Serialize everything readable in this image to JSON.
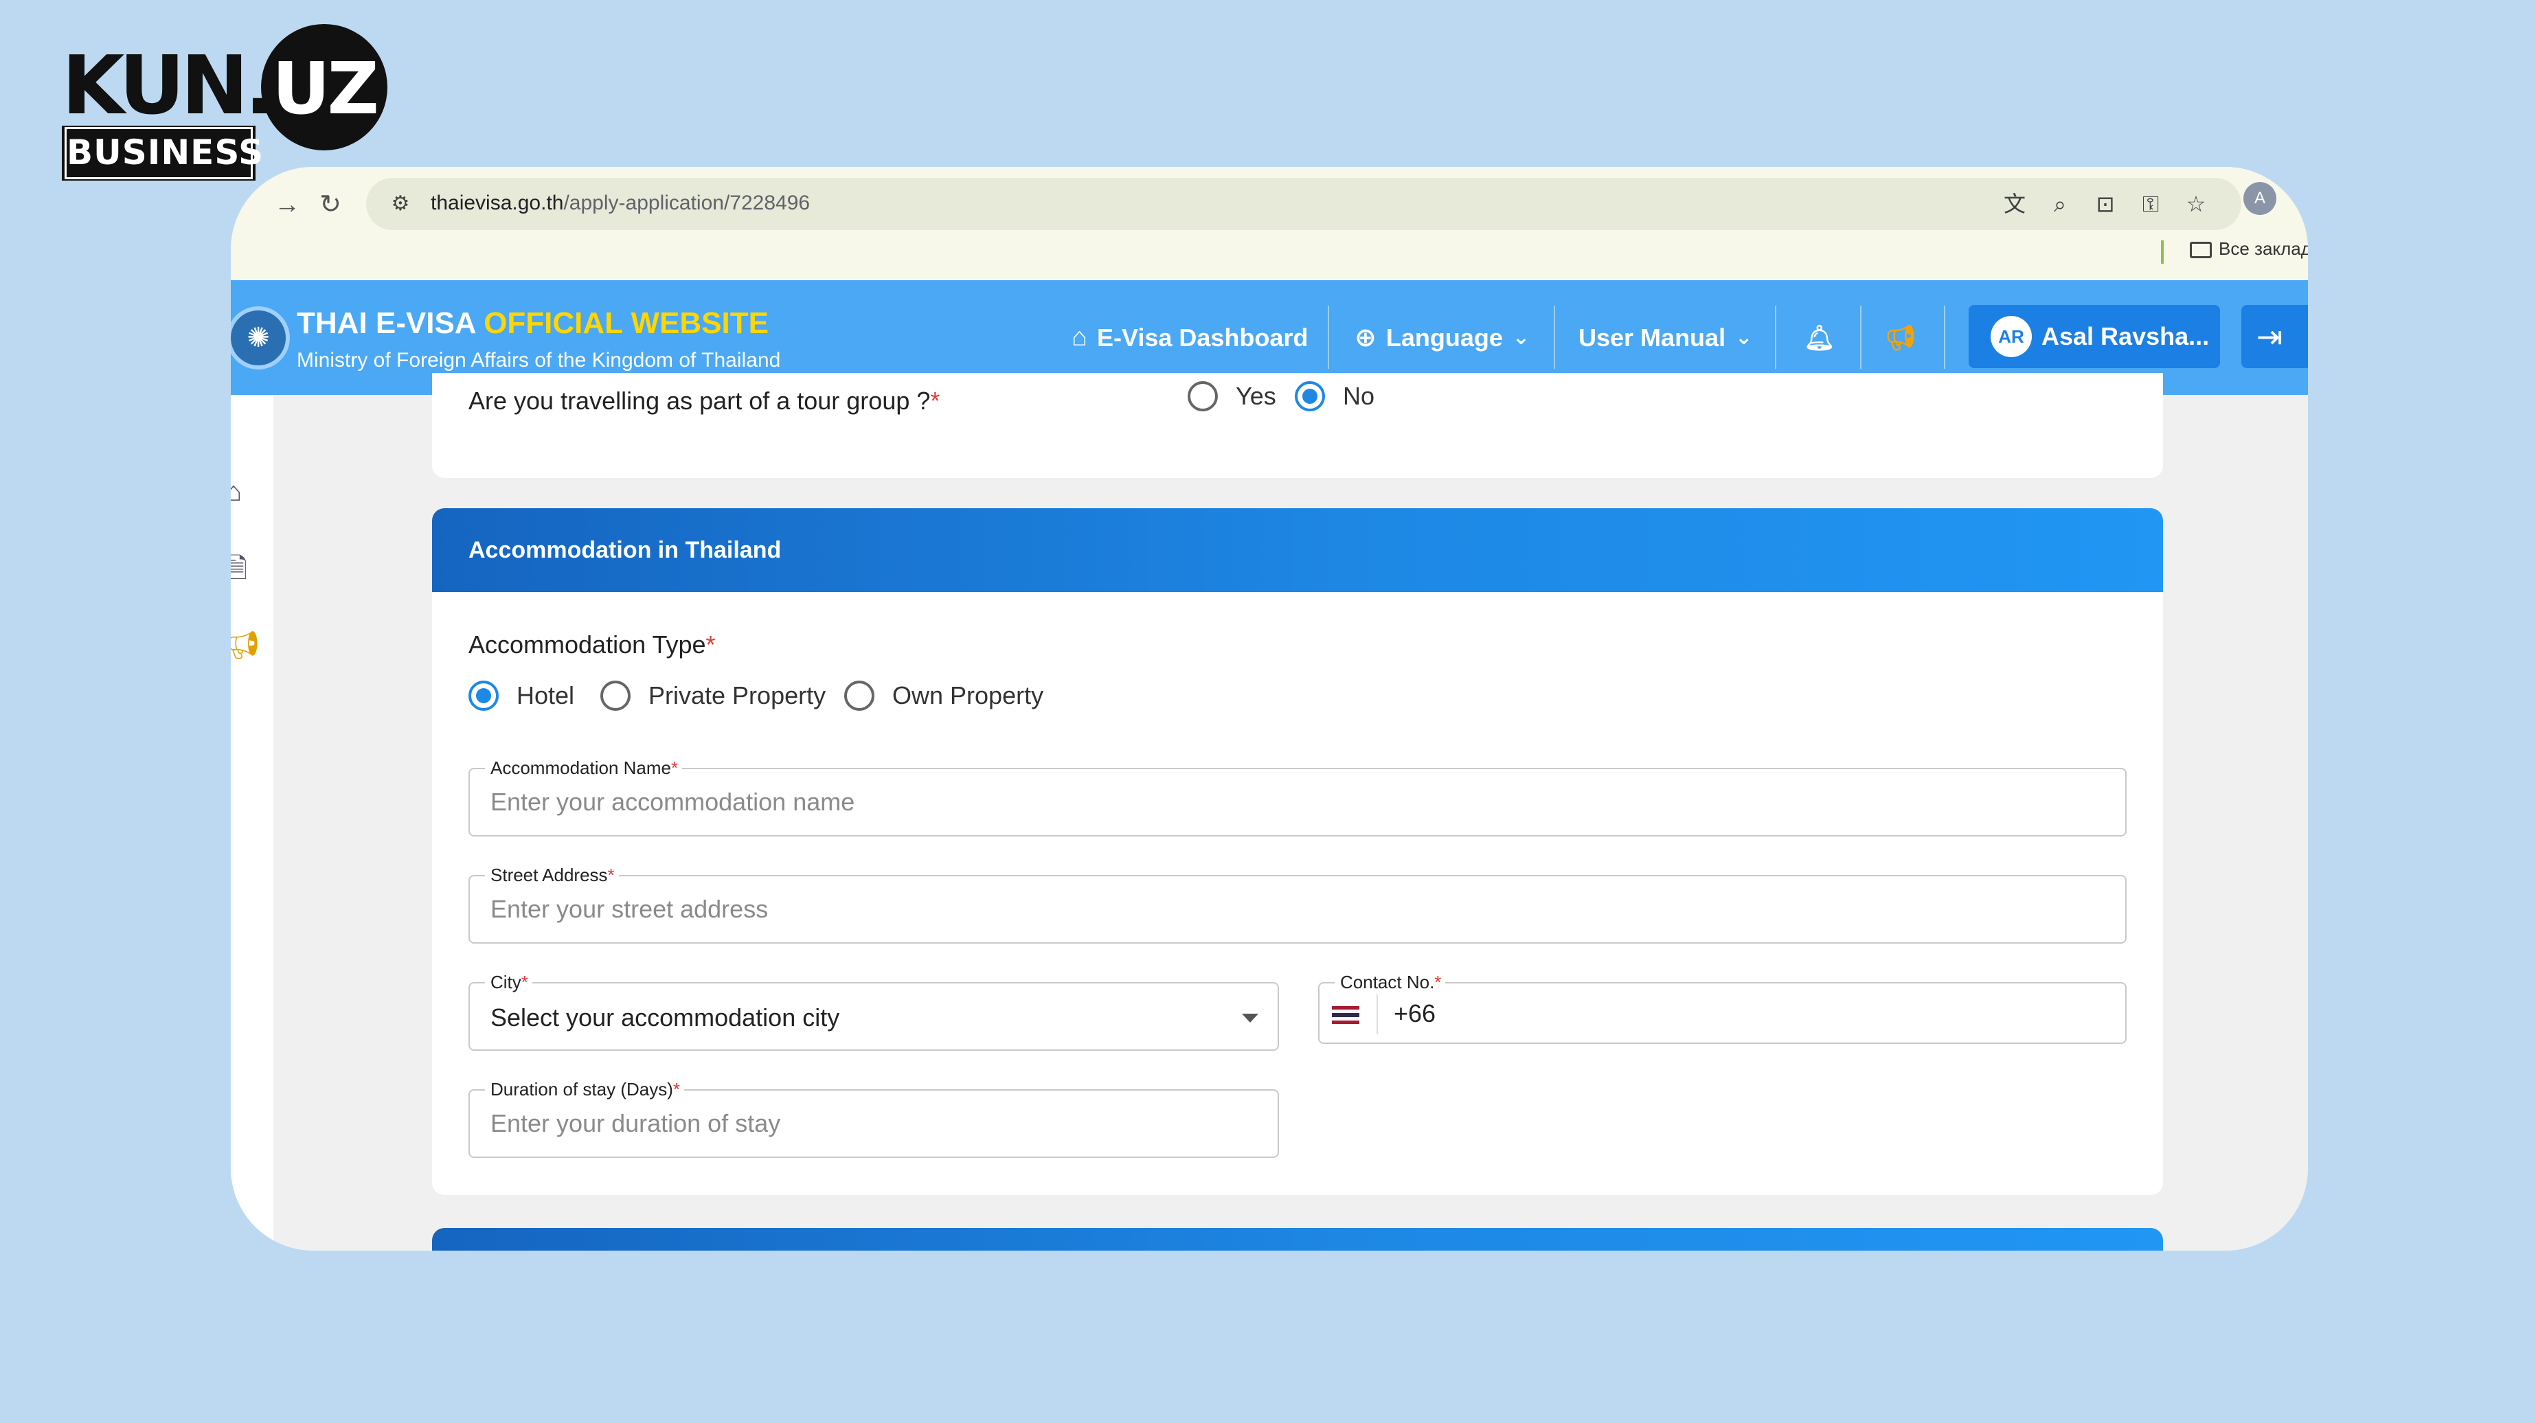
{
  "brand": {
    "name": "KUN.UZ",
    "sub": "BUSINESS"
  },
  "browser": {
    "url_host": "thaievisa.go.th",
    "url_path": "/apply-application/7228496",
    "profile_initial": "A",
    "bookmarks_label": "Все заклад"
  },
  "site": {
    "title_main": "THAI E-VISA",
    "title_highlight": "OFFICIAL WEBSITE",
    "subtitle": "Ministry of Foreign Affairs of the Kingdom of Thailand",
    "nav": {
      "dashboard": "E-Visa Dashboard",
      "language": "Language",
      "user_manual": "User Manual"
    },
    "user": {
      "initials": "AR",
      "name": "Asal Ravsha..."
    }
  },
  "tour": {
    "question": "Are you travelling as part of a tour group ?",
    "options": [
      "Yes",
      "No"
    ],
    "selected": "No"
  },
  "accommodation": {
    "section_title": "Accommodation in Thailand",
    "type_label": "Accommodation Type",
    "types": [
      "Hotel",
      "Private Property",
      "Own Property"
    ],
    "selected_type": "Hotel",
    "fields": {
      "name": {
        "label": "Accommodation Name",
        "placeholder": "Enter your accommodation name"
      },
      "street": {
        "label": "Street Address",
        "placeholder": "Enter your street address"
      },
      "city": {
        "label": "City",
        "value": "Select your accommodation city"
      },
      "contact": {
        "label": "Contact No.",
        "value": "+66"
      },
      "duration": {
        "label": "Duration of stay (Days)",
        "placeholder": "Enter your duration of stay"
      }
    }
  },
  "colors": {
    "page_bg": "#bdd9f2",
    "header_bg": "#4aa8f4",
    "accent": "#1e88e5",
    "title_highlight": "#ffd600",
    "required": "#e53935"
  }
}
